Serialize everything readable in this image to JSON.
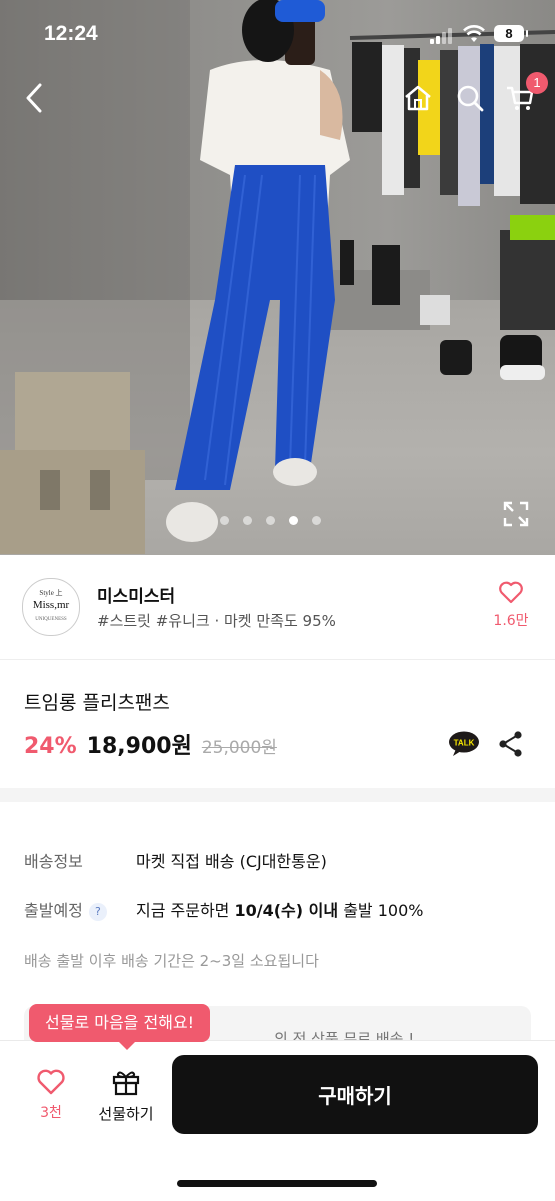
{
  "status_bar": {
    "time": "12:24",
    "battery": "8"
  },
  "header": {
    "cart_count": "1"
  },
  "gallery": {
    "pages": 5,
    "active_page": 4
  },
  "seller": {
    "logo_line1": "Style 上",
    "logo_line2": "Miss,mr",
    "logo_line3": "UNIQUENESS",
    "name": "미스미스터",
    "tags": "#스트릿 #유니크 · 마켓 만족도 95%",
    "likes": "1.6만"
  },
  "product": {
    "name": "트임롱 플리츠팬츠",
    "discount": "24%",
    "price": "18,900원",
    "original_price": "25,000원"
  },
  "delivery": {
    "shipping_label": "배송정보",
    "shipping_value": "마켓 직접 배송 (CJ대한통운)",
    "departure_label": "출발예정",
    "departure_prefix": "지금 주문하면 ",
    "departure_bold": "10/4(수) 이내",
    "departure_suffix": " 출발 100%",
    "note": "배송 출발 이후 배송 기간은 2~3일 소요됩니다",
    "card_partial": "의 전 상품 무료 배송 !"
  },
  "bottom_bar": {
    "tooltip": "선물로 마음을 전해요!",
    "like_count": "3천",
    "gift_label": "선물하기",
    "buy_label": "구매하기"
  },
  "colors": {
    "accent": "#f05a6e",
    "buy_button": "#111111",
    "pants": "#1f4fc4"
  }
}
